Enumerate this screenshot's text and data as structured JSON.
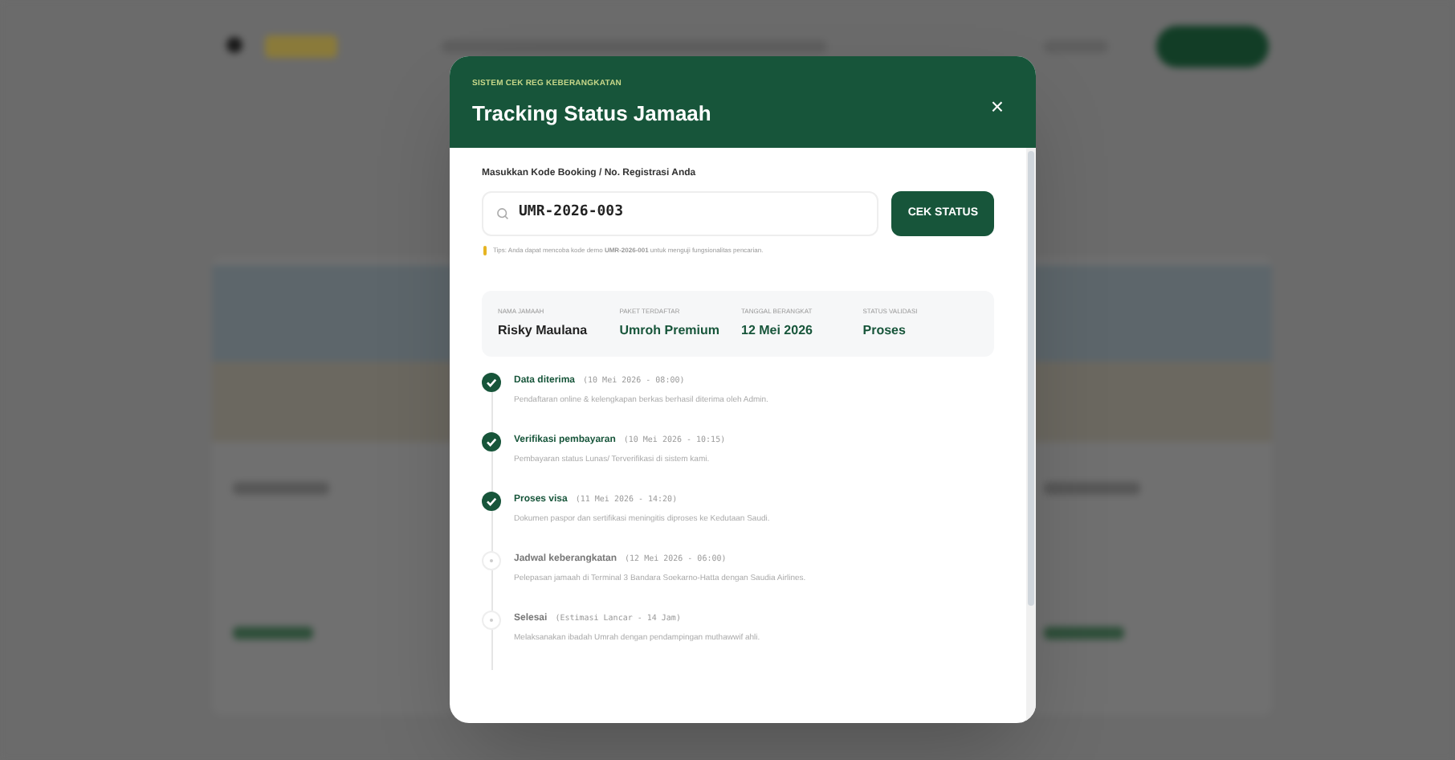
{
  "modal": {
    "eyebrow": "SISTEM CEK REG KEBERANGKATAN",
    "title": "Tracking Status Jamaah",
    "close": "×",
    "search": {
      "label": "Masukkan Kode Booking / No. Registrasi Anda",
      "value": "UMR-2026-003",
      "button": "CEK STATUS",
      "hint": "Tips: Anda dapat mencoba kode demo **UMR-2026-001** untuk menguji fungsionalitas pencarian."
    },
    "summary": [
      {
        "label": "NAMA JAMAAH",
        "value": "Risky Maulana"
      },
      {
        "label": "PAKET TERDAFTAR",
        "value": "Umroh Premium"
      },
      {
        "label": "TANGGAL BERANGKAT",
        "value": "12 Mei 2026"
      },
      {
        "label": "STATUS VALIDASI",
        "value": "Proses"
      }
    ],
    "steps": [
      {
        "title": "Data diterima",
        "time": "(10 Mei 2026 - 08:00)",
        "description": "Pendaftaran online & kelengkapan berkas berhasil diterima oleh Admin.",
        "done": true
      },
      {
        "title": "Verifikasi pembayaran",
        "time": "(10 Mei 2026 - 10:15)",
        "description": "Pembayaran status Lunas/ Terverifikasi di sistem kami.",
        "done": true
      },
      {
        "title": "Proses visa",
        "time": "(11 Mei 2026 - 14:20)",
        "description": "Dokumen paspor dan sertifikasi meningitis diproses ke Kedutaan Saudi.",
        "done": true
      },
      {
        "title": "Jadwal keberangkatan",
        "time": "(12 Mei 2026 - 06:00)",
        "description": "Pelepasan jamaah di Terminal 3 Bandara Soekarno-Hatta dengan Saudia Airlines.",
        "done": false
      },
      {
        "title": "Selesai",
        "time": "(Estimasi Lancar - 14 Jam)",
        "description": "Melaksanakan ibadah Umrah dengan pendampingan muthawwif ahli.",
        "done": false
      }
    ]
  }
}
